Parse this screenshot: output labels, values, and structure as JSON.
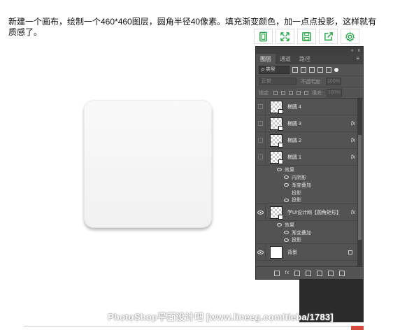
{
  "intro_text": "新建一个画布，绘制一个460*460图层，圆角半径40像素。填充渐变颜色，加一点点投影，这样就有质感了。",
  "toolstrip": {
    "buttons": [
      "doc-icon",
      "expand-icon",
      "save-icon",
      "share-icon",
      "settings-icon"
    ],
    "accent_color": "#2fa84f"
  },
  "panel": {
    "topbar_collapse": "«",
    "topbar_close": "x",
    "tabs": [
      "图层",
      "通道",
      "路径"
    ],
    "menu_glyph": "≡",
    "filter_label": "ρ 类型",
    "blend_mode": "正常",
    "opacity_label": "不透明度:",
    "opacity_value": "100%",
    "lock_label": "锁定:",
    "fill_label": "填充:",
    "fill_value": "100%",
    "layers": [
      {
        "name": "椭圆 4",
        "fx": ""
      },
      {
        "name": "椭圆 3",
        "fx": "fx"
      },
      {
        "name": "椭圆 2",
        "fx": "fx"
      },
      {
        "name": "椭圆 1",
        "fx": "fx"
      }
    ],
    "effects_1": {
      "label": "效果",
      "items": [
        "内阴影",
        "渐变叠加",
        "投影",
        "投影"
      ]
    },
    "main_layer": {
      "name": "学UI设计网【圆角矩形】",
      "fx": "fx"
    },
    "effects_2": {
      "label": "效果",
      "items": [
        "渐变叠加",
        "投影"
      ]
    },
    "background_layer": {
      "name": "背景"
    },
    "footer_icons": [
      "link-icon",
      "fx-icon",
      "mask-icon",
      "adjustment-icon",
      "folder-icon",
      "new-layer-icon",
      "trash-icon"
    ],
    "footer_fx": "fx"
  },
  "watermark": "PhotoShop平面设计吧 [www.lineeg.com/tieba/1783]"
}
